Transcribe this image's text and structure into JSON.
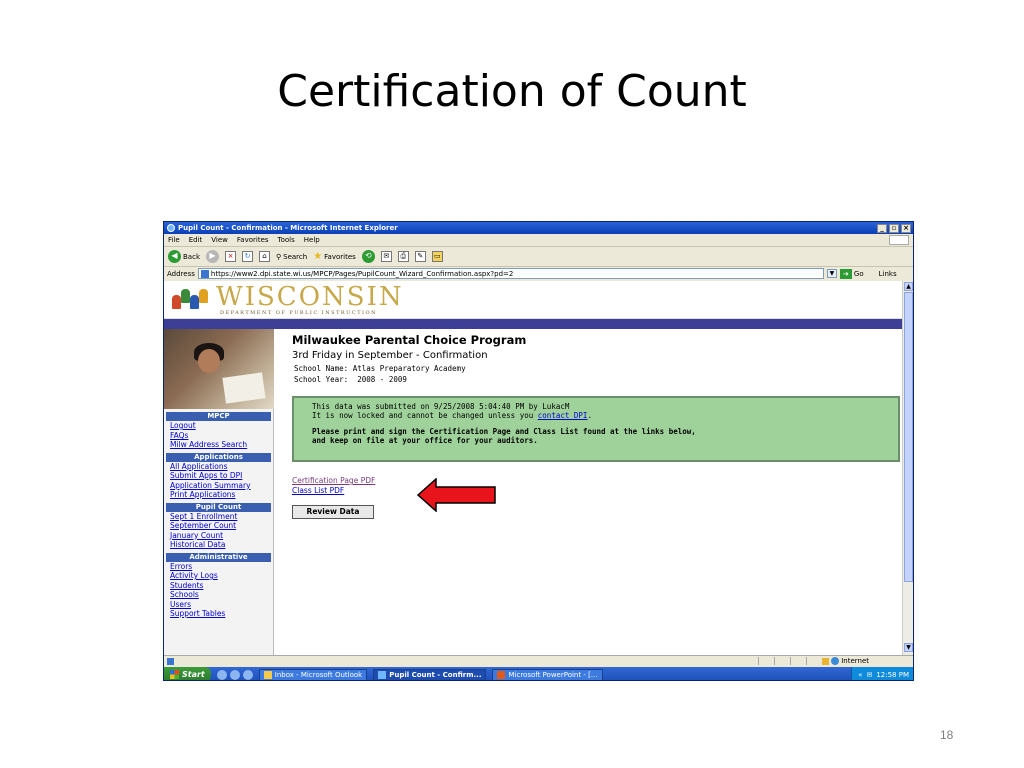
{
  "slide": {
    "title": "Certification of Count",
    "page_number": "18"
  },
  "browser": {
    "window_title": "Pupil Count - Confirmation - Microsoft Internet Explorer",
    "menu": [
      "File",
      "Edit",
      "View",
      "Favorites",
      "Tools",
      "Help"
    ],
    "toolbar": {
      "back": "Back",
      "search": "Search",
      "favorites": "Favorites"
    },
    "address_label": "Address",
    "url": "https://www2.dpi.state.wi.us/MPCP/Pages/PupilCount_Wizard_Confirmation.aspx?pd=2",
    "go_label": "Go",
    "links_label": "Links",
    "status_zone": "Internet"
  },
  "site": {
    "logo_name": "WISCONSIN",
    "logo_subtitle": "DEPARTMENT OF PUBLIC INSTRUCTION"
  },
  "sidebar": {
    "sections": [
      {
        "title": "MPCP",
        "links": [
          "Logout",
          "FAQs",
          "Milw Address Search"
        ]
      },
      {
        "title": "Applications",
        "links": [
          "All Applications",
          "Submit Apps to DPI",
          "Application Summary",
          "Print Applications"
        ]
      },
      {
        "title": "Pupil Count",
        "links": [
          "Sept 1 Enrollment",
          "September Count",
          "January Count",
          "Historical Data"
        ]
      },
      {
        "title": "Administrative",
        "links": [
          "Errors",
          "Activity Logs",
          "Students",
          "Schools",
          "Users",
          "Support Tables"
        ]
      }
    ]
  },
  "main": {
    "program_title": "Milwaukee Parental Choice Program",
    "subtitle": "3rd Friday in September - Confirmation",
    "school_name": "School Name: Atlas Preparatory Academy",
    "school_year": "School Year:  2008 - 2009",
    "notice_line1": "This data was submitted on 9/25/2008 5:04:40 PM by LukacM",
    "notice_line2_prefix": "It is now locked and cannot be changed unless you ",
    "notice_link": "contact DPI",
    "notice_line2_suffix": ".",
    "notice_bold1": "Please print and sign the Certification Page and Class List found at the links below,",
    "notice_bold2": "and keep on file at your office for your auditors.",
    "cert_link": "Certification Page PDF",
    "class_link": "Class List PDF",
    "review_button": "Review Data"
  },
  "taskbar": {
    "start": "Start",
    "tasks": [
      "Inbox - Microsoft Outlook",
      "Pupil Count - Confirm...",
      "Microsoft PowerPoint - [..."
    ],
    "clock": "12:58 PM"
  },
  "colors": {
    "notice_bg": "#9fd29b",
    "arrow_red": "#e8141c",
    "nav_stripe": "#3d3f97"
  }
}
